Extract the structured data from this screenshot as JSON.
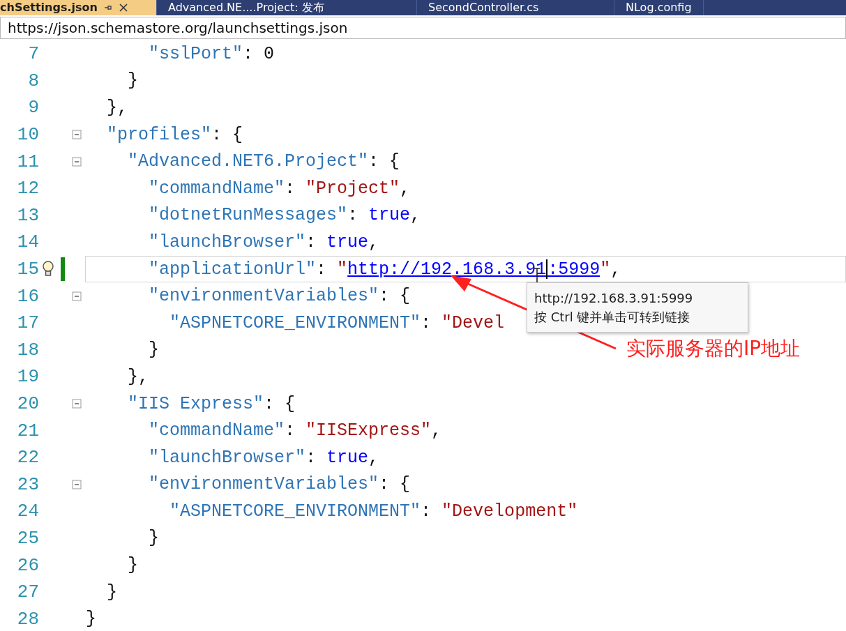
{
  "tabs": [
    {
      "label": "chSettings.json",
      "selected": true
    },
    {
      "label": "Advanced.NE....Project: 发布",
      "selected": false
    },
    {
      "label": "SecondController.cs",
      "selected": false
    },
    {
      "label": "NLog.config",
      "selected": false
    }
  ],
  "schema_bar": {
    "value": "https://json.schemastore.org/launchsettings.json"
  },
  "lines": [
    {
      "number": "7",
      "foldable": false,
      "current": false,
      "lightbulb": false,
      "changed": false,
      "tokens": [
        {
          "kind": "key",
          "text": "\"sslPort\""
        },
        {
          "kind": "punct",
          "text": ": "
        },
        {
          "kind": "number",
          "text": "0"
        }
      ]
    },
    {
      "number": "8",
      "foldable": false,
      "current": false,
      "lightbulb": false,
      "changed": false,
      "tokens": [
        {
          "kind": "punct",
          "text": "}"
        }
      ]
    },
    {
      "number": "9",
      "foldable": false,
      "current": false,
      "lightbulb": false,
      "changed": false,
      "tokens": [
        {
          "kind": "punct",
          "text": "},"
        }
      ]
    },
    {
      "number": "10",
      "foldable": true,
      "current": false,
      "lightbulb": false,
      "changed": false,
      "tokens": [
        {
          "kind": "key",
          "text": "\"profiles\""
        },
        {
          "kind": "punct",
          "text": ": {"
        }
      ]
    },
    {
      "number": "11",
      "foldable": true,
      "current": false,
      "lightbulb": false,
      "changed": false,
      "tokens": [
        {
          "kind": "key",
          "text": "\"Advanced.NET6.Project\""
        },
        {
          "kind": "punct",
          "text": ": {"
        }
      ]
    },
    {
      "number": "12",
      "foldable": false,
      "current": false,
      "lightbulb": false,
      "changed": false,
      "tokens": [
        {
          "kind": "key",
          "text": "\"commandName\""
        },
        {
          "kind": "punct",
          "text": ": "
        },
        {
          "kind": "string",
          "text": "\"Project\""
        },
        {
          "kind": "punct",
          "text": ","
        }
      ]
    },
    {
      "number": "13",
      "foldable": false,
      "current": false,
      "lightbulb": false,
      "changed": false,
      "tokens": [
        {
          "kind": "key",
          "text": "\"dotnetRunMessages\""
        },
        {
          "kind": "punct",
          "text": ": "
        },
        {
          "kind": "literal",
          "text": "true"
        },
        {
          "kind": "punct",
          "text": ","
        }
      ]
    },
    {
      "number": "14",
      "foldable": false,
      "current": false,
      "lightbulb": false,
      "changed": false,
      "tokens": [
        {
          "kind": "key",
          "text": "\"launchBrowser\""
        },
        {
          "kind": "punct",
          "text": ": "
        },
        {
          "kind": "literal",
          "text": "true"
        },
        {
          "kind": "punct",
          "text": ","
        }
      ]
    },
    {
      "number": "15",
      "foldable": false,
      "current": true,
      "lightbulb": true,
      "changed": true,
      "tokens": [
        {
          "kind": "key",
          "text": "\"applicationUrl\""
        },
        {
          "kind": "punct",
          "text": ": "
        },
        {
          "kind": "string",
          "text": "\""
        },
        {
          "kind": "link",
          "text": "http://192.168.3.91"
        },
        {
          "kind": "caret"
        },
        {
          "kind": "link",
          "text": ":5999"
        },
        {
          "kind": "string",
          "text": "\""
        },
        {
          "kind": "punct",
          "text": ","
        }
      ]
    },
    {
      "number": "16",
      "foldable": true,
      "current": false,
      "lightbulb": false,
      "changed": false,
      "tokens": [
        {
          "kind": "key",
          "text": "\"environmentVariables\""
        },
        {
          "kind": "punct",
          "text": ": {"
        }
      ]
    },
    {
      "number": "17",
      "foldable": false,
      "current": false,
      "lightbulb": false,
      "changed": false,
      "tokens": [
        {
          "kind": "key",
          "text": "\"ASPNETCORE_ENVIRONMENT\""
        },
        {
          "kind": "punct",
          "text": ": "
        },
        {
          "kind": "string",
          "text": "\"Devel"
        }
      ]
    },
    {
      "number": "18",
      "foldable": false,
      "current": false,
      "lightbulb": false,
      "changed": false,
      "tokens": [
        {
          "kind": "punct",
          "text": "}"
        }
      ]
    },
    {
      "number": "19",
      "foldable": false,
      "current": false,
      "lightbulb": false,
      "changed": false,
      "tokens": [
        {
          "kind": "punct",
          "text": "},"
        }
      ]
    },
    {
      "number": "20",
      "foldable": true,
      "current": false,
      "lightbulb": false,
      "changed": false,
      "tokens": [
        {
          "kind": "key",
          "text": "\"IIS Express\""
        },
        {
          "kind": "punct",
          "text": ": {"
        }
      ]
    },
    {
      "number": "21",
      "foldable": false,
      "current": false,
      "lightbulb": false,
      "changed": false,
      "tokens": [
        {
          "kind": "key",
          "text": "\"commandName\""
        },
        {
          "kind": "punct",
          "text": ": "
        },
        {
          "kind": "string",
          "text": "\"IISExpress\""
        },
        {
          "kind": "punct",
          "text": ","
        }
      ]
    },
    {
      "number": "22",
      "foldable": false,
      "current": false,
      "lightbulb": false,
      "changed": false,
      "tokens": [
        {
          "kind": "key",
          "text": "\"launchBrowser\""
        },
        {
          "kind": "punct",
          "text": ": "
        },
        {
          "kind": "literal",
          "text": "true"
        },
        {
          "kind": "punct",
          "text": ","
        }
      ]
    },
    {
      "number": "23",
      "foldable": true,
      "current": false,
      "lightbulb": false,
      "changed": false,
      "tokens": [
        {
          "kind": "key",
          "text": "\"environmentVariables\""
        },
        {
          "kind": "punct",
          "text": ": {"
        }
      ]
    },
    {
      "number": "24",
      "foldable": false,
      "current": false,
      "lightbulb": false,
      "changed": false,
      "tokens": [
        {
          "kind": "key",
          "text": "\"ASPNETCORE_ENVIRONMENT\""
        },
        {
          "kind": "punct",
          "text": ": "
        },
        {
          "kind": "string",
          "text": "\"Development\""
        }
      ]
    },
    {
      "number": "25",
      "foldable": false,
      "current": false,
      "lightbulb": false,
      "changed": false,
      "tokens": [
        {
          "kind": "punct",
          "text": "}"
        }
      ]
    },
    {
      "number": "26",
      "foldable": false,
      "current": false,
      "lightbulb": false,
      "changed": false,
      "tokens": [
        {
          "kind": "punct",
          "text": "}"
        }
      ]
    },
    {
      "number": "27",
      "foldable": false,
      "current": false,
      "lightbulb": false,
      "changed": false,
      "tokens": [
        {
          "kind": "punct",
          "text": "}"
        }
      ]
    },
    {
      "number": "28",
      "foldable": false,
      "current": false,
      "lightbulb": false,
      "changed": false,
      "tokens": [
        {
          "kind": "punct",
          "text": "}"
        }
      ]
    }
  ],
  "tooltip": {
    "lines": [
      "http://192.168.3.91:5999",
      "按 Ctrl 键并单击可转到链接"
    ]
  },
  "annotation": {
    "text": "实际服务器的IP地址",
    "color": "#ff2020"
  }
}
